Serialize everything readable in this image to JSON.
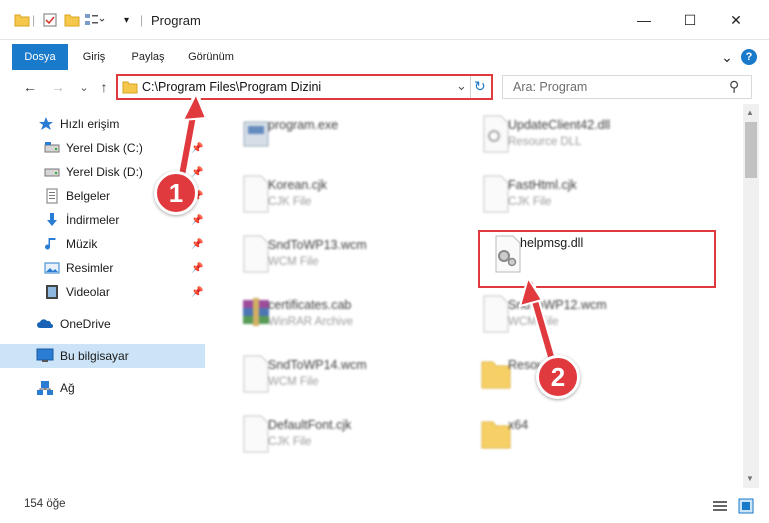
{
  "window": {
    "title": "Program",
    "minimize_glyph": "—",
    "maximize_glyph": "☐",
    "close_glyph": "✕"
  },
  "ribbon": {
    "tabs": [
      "Dosya",
      "Giriş",
      "Paylaş",
      "Görünüm"
    ],
    "active_tab": "Dosya",
    "expand_glyph": "⌄",
    "help_glyph": "?"
  },
  "address": {
    "path": "C:\\Program Files\\Program Dizini",
    "dropdown_glyph": "⌄",
    "refresh_glyph": "↻"
  },
  "search": {
    "placeholder": "Ara: Program",
    "icon_glyph": "⚲"
  },
  "nav": {
    "back_glyph": "←",
    "forward_glyph": "→",
    "recent_glyph": "⌄",
    "up_glyph": "↑"
  },
  "sidebar": {
    "quick_access": "Hızlı erişim",
    "items": [
      {
        "label": "Yerel Disk (C:)",
        "icon": "drive-icon",
        "pinned": true
      },
      {
        "label": "Yerel Disk (D:)",
        "icon": "drive-icon",
        "pinned": true
      },
      {
        "label": "Belgeler",
        "icon": "documents-icon",
        "pinned": true
      },
      {
        "label": "İndirmeler",
        "icon": "downloads-icon",
        "pinned": true
      },
      {
        "label": "Müzik",
        "icon": "music-icon",
        "pinned": true
      },
      {
        "label": "Resimler",
        "icon": "pictures-icon",
        "pinned": true
      },
      {
        "label": "Videolar",
        "icon": "videos-icon",
        "pinned": true
      }
    ],
    "onedrive": "OneDrive",
    "this_pc": "Bu bilgisayar",
    "network": "Ağ"
  },
  "files": [
    {
      "name": "program.exe",
      "type": "",
      "icon": "exe-icon",
      "blurred": true
    },
    {
      "name": "UpdateClient42.dll",
      "type": "Resource DLL",
      "icon": "dll-icon",
      "blurred": true
    },
    {
      "name": "Korean.cjk",
      "type": "CJK File",
      "icon": "file-icon",
      "blurred": true
    },
    {
      "name": "FastHtml.cjk",
      "type": "CJK File",
      "icon": "file-icon",
      "blurred": true
    },
    {
      "name": "SndToWP13.wcm",
      "type": "WCM File",
      "icon": "file-icon",
      "blurred": true
    },
    {
      "name": "helpmsg.dll",
      "type": "",
      "icon": "dll-gear-icon",
      "blurred": false
    },
    {
      "name": "certificates.cab",
      "type": "WinRAR Archive",
      "icon": "archive-icon",
      "blurred": true
    },
    {
      "name": "SndToWP12.wcm",
      "type": "WCM File",
      "icon": "file-icon",
      "blurred": true
    },
    {
      "name": "SndToWP14.wcm",
      "type": "WCM File",
      "icon": "file-icon",
      "blurred": true
    },
    {
      "name": "Resource",
      "type": "",
      "icon": "folder-icon",
      "blurred": true
    },
    {
      "name": "DefaultFont.cjk",
      "type": "CJK File",
      "icon": "file-icon",
      "blurred": true
    },
    {
      "name": "x64",
      "type": "",
      "icon": "folder-icon",
      "blurred": true
    }
  ],
  "callouts": [
    "1",
    "2"
  ],
  "status": {
    "count": "154 öğe"
  },
  "colors": {
    "accent": "#1979ca",
    "highlight": "#e0393e",
    "selected_bg": "#cce4f7"
  }
}
